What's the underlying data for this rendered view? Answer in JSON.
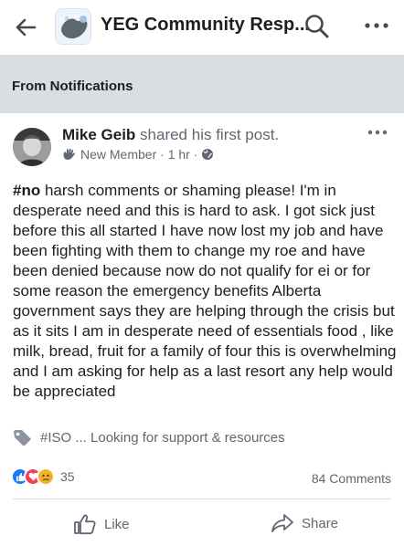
{
  "header": {
    "group_title": "YEG Community Resp...",
    "back_icon": "arrow-left-icon",
    "search_icon": "search-icon",
    "more_icon": "more-horizontal-icon"
  },
  "notification": {
    "label": "From Notifications"
  },
  "post": {
    "author": "Mike Geib",
    "action": " shared his first post.",
    "badge": "New Member",
    "time": "1 hr",
    "hashtag": "#no",
    "body": " harsh comments or shaming please! I'm in desperate need and this is hard to ask. I got sick just before this all started I have now lost my job and have been fighting with them to change my roe and have been denied because now do not qualify for ei or for some reason the emergency benefits Alberta government says they are helping through the crisis but as it sits I am in desperate need of essentials food , like milk, bread, fruit for a family of four this is overwhelming and I am asking for help as a last resort any help would be appreciated",
    "topic": "#ISO ... Looking for support & resources"
  },
  "engagement": {
    "reaction_count": "35",
    "comments": "84 Comments",
    "like_label": "Like",
    "share_label": "Share"
  },
  "colors": {
    "like_blue": "#1877f2",
    "love_red": "#f33e58",
    "sad_yellow": "#f7b125",
    "notification_bg": "#dadde1",
    "secondary_text": "#606770"
  }
}
